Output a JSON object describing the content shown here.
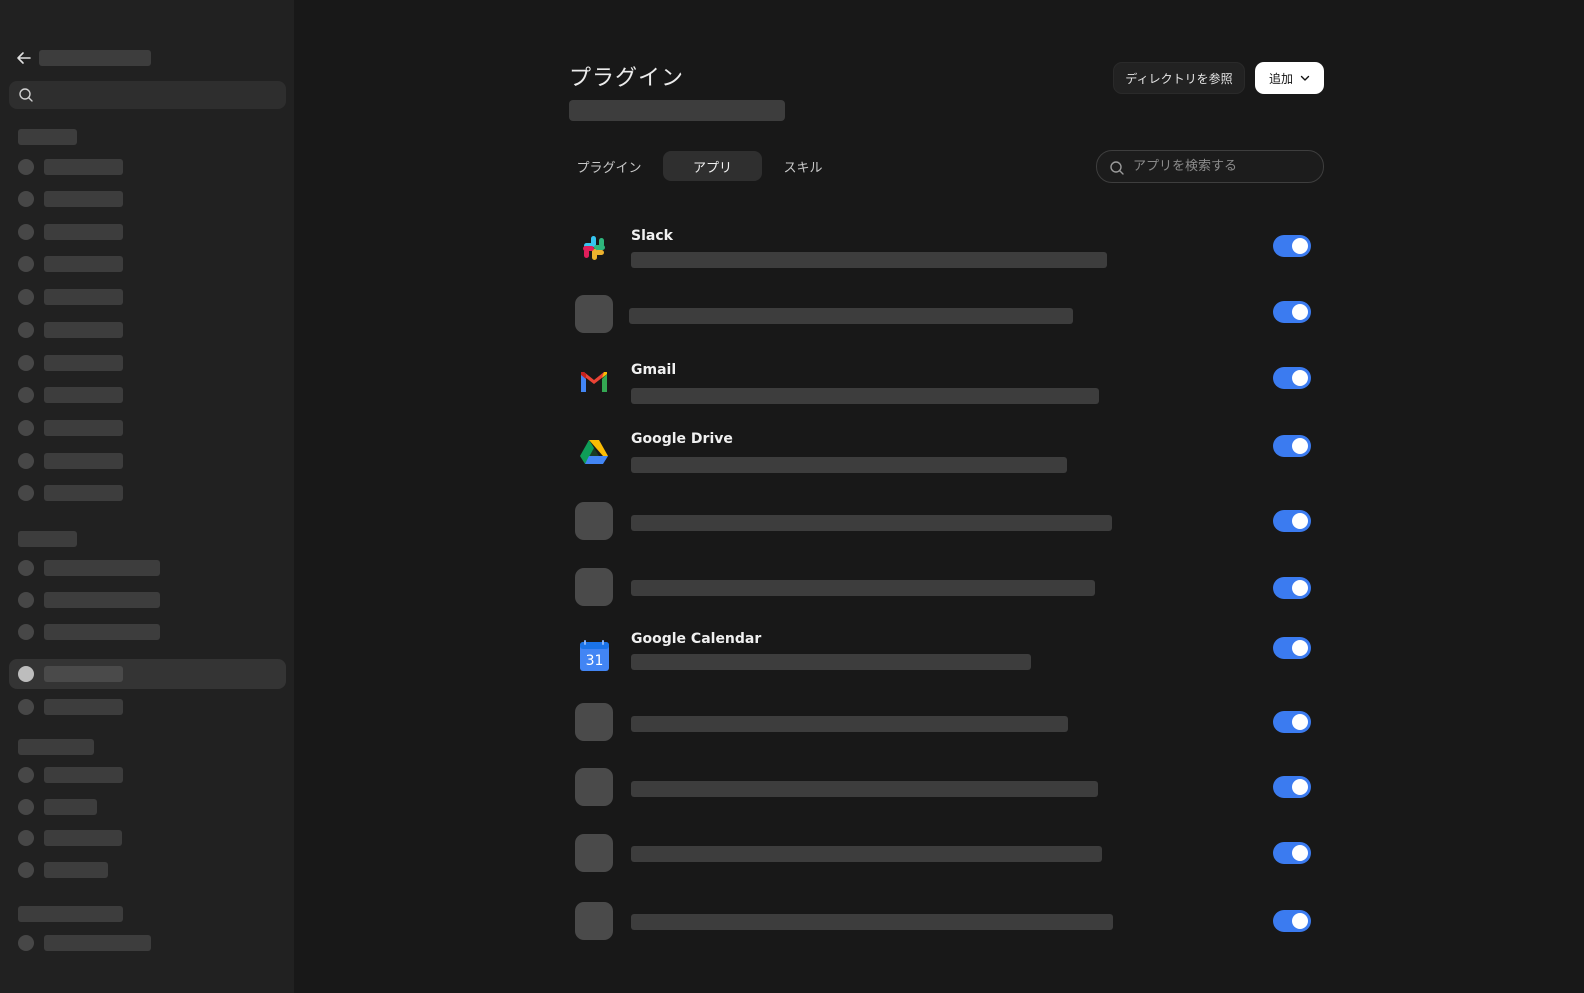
{
  "page": {
    "title": "プラグイン"
  },
  "header": {
    "browse_label": "ディレクトリを参照",
    "add_label": "追加"
  },
  "tabs": [
    {
      "label": "プラグイン",
      "selected": false
    },
    {
      "label": "アプリ",
      "selected": true
    },
    {
      "label": "スキル",
      "selected": false
    }
  ],
  "search": {
    "placeholder": "アプリを検索する",
    "value": ""
  },
  "apps": [
    {
      "name": "Slack",
      "icon": "slack-icon",
      "enabled": true
    },
    {
      "name": "",
      "icon": "placeholder-icon",
      "enabled": true
    },
    {
      "name": "Gmail",
      "icon": "gmail-icon",
      "enabled": true
    },
    {
      "name": "Google Drive",
      "icon": "google-drive-icon",
      "enabled": true
    },
    {
      "name": "",
      "icon": "placeholder-icon",
      "enabled": true
    },
    {
      "name": "",
      "icon": "placeholder-icon",
      "enabled": true
    },
    {
      "name": "Google Calendar",
      "icon": "google-calendar-icon",
      "calendar_day": "31",
      "enabled": true
    },
    {
      "name": "",
      "icon": "placeholder-icon",
      "enabled": true
    },
    {
      "name": "",
      "icon": "placeholder-icon",
      "enabled": true
    },
    {
      "name": "",
      "icon": "placeholder-icon",
      "enabled": true
    },
    {
      "name": "",
      "icon": "placeholder-icon",
      "enabled": true
    }
  ],
  "colors": {
    "toggle_on": "#3b7bf0",
    "background": "#181818",
    "sidebar": "#212121"
  }
}
